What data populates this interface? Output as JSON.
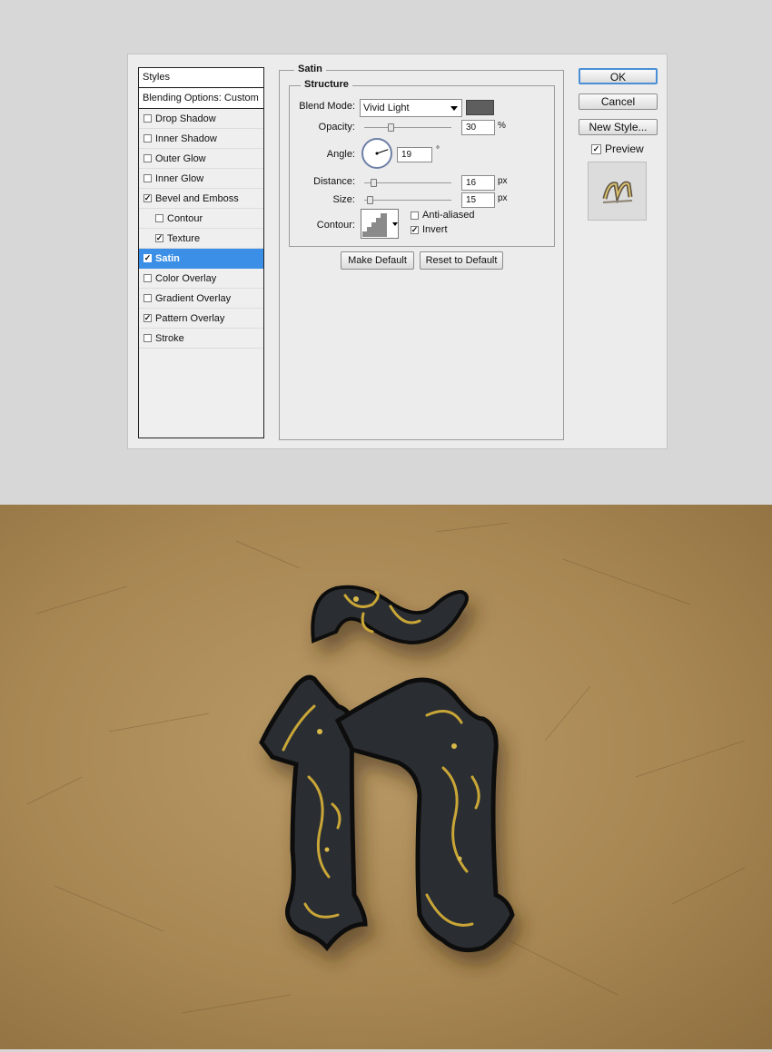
{
  "styles_panel": {
    "header": "Styles",
    "blending_options": "Blending Options: Custom",
    "items": [
      {
        "label": "Drop Shadow",
        "checked": false,
        "indent": false,
        "selected": false
      },
      {
        "label": "Inner Shadow",
        "checked": false,
        "indent": false,
        "selected": false
      },
      {
        "label": "Outer Glow",
        "checked": false,
        "indent": false,
        "selected": false
      },
      {
        "label": "Inner Glow",
        "checked": false,
        "indent": false,
        "selected": false
      },
      {
        "label": "Bevel and Emboss",
        "checked": true,
        "indent": false,
        "selected": false
      },
      {
        "label": "Contour",
        "checked": false,
        "indent": true,
        "selected": false
      },
      {
        "label": "Texture",
        "checked": true,
        "indent": true,
        "selected": false
      },
      {
        "label": "Satin",
        "checked": true,
        "indent": false,
        "selected": true
      },
      {
        "label": "Color Overlay",
        "checked": false,
        "indent": false,
        "selected": false
      },
      {
        "label": "Gradient Overlay",
        "checked": false,
        "indent": false,
        "selected": false
      },
      {
        "label": "Pattern Overlay",
        "checked": true,
        "indent": false,
        "selected": false
      },
      {
        "label": "Stroke",
        "checked": false,
        "indent": false,
        "selected": false
      }
    ]
  },
  "satin": {
    "title": "Satin",
    "structure_title": "Structure",
    "blend_mode_label": "Blend Mode:",
    "blend_mode_value": "Vivid Light",
    "blend_color": "#5e5e5e",
    "opacity_label": "Opacity:",
    "opacity_value": "30",
    "opacity_unit": "%",
    "opacity_fraction": 0.3,
    "angle_label": "Angle:",
    "angle_value": "19",
    "angle_unit": "°",
    "distance_label": "Distance:",
    "distance_value": "16",
    "distance_unit": "px",
    "distance_fraction": 0.1,
    "size_label": "Size:",
    "size_value": "15",
    "size_unit": "px",
    "size_fraction": 0.06,
    "contour_label": "Contour:",
    "anti_aliased_label": "Anti-aliased",
    "anti_aliased_checked": false,
    "invert_label": "Invert",
    "invert_checked": true,
    "make_default_label": "Make Default",
    "reset_default_label": "Reset to Default"
  },
  "buttons": {
    "ok": "OK",
    "cancel": "Cancel",
    "new_style": "New Style...",
    "preview_label": "Preview",
    "preview_checked": true
  },
  "colors": {
    "selection_blue": "#3b8fe6",
    "parchment": "#a88753",
    "letter_black": "#2b2d30",
    "ornament_gold": "#c9a637"
  },
  "artwork": {
    "subject": "ornate-letter-n-tilde"
  }
}
